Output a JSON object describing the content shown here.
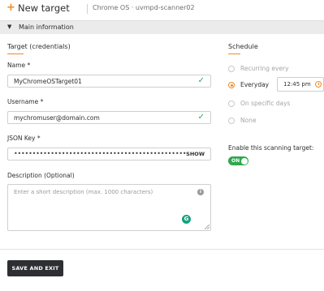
{
  "header": {
    "title": "New target",
    "breadcrumb": "Chrome OS · uvmpd-scanner02"
  },
  "section": {
    "title": "Main information"
  },
  "credentials": {
    "title": "Target (credentials)",
    "name_label": "Name *",
    "name_value": "MyChromeOSTarget01",
    "username_label": "Username *",
    "username_value": "mychromuser@domain.com",
    "json_key_label": "JSON Key *",
    "json_key_value": "•••••••••••••••••••••••••••••••••••••••••••••••••••••••••••••••••••••••",
    "json_key_show": "SHOW",
    "description_label": "Description (Optional)",
    "description_placeholder": "Enter a short description (max. 1000 characters)",
    "grammarly_glyph": "G"
  },
  "schedule": {
    "title": "Schedule",
    "options": [
      {
        "label": "Recurring every",
        "selected": false
      },
      {
        "label": "Everyday",
        "selected": true
      },
      {
        "label": "On specific days",
        "selected": false
      },
      {
        "label": "None",
        "selected": false
      }
    ],
    "time_value": "12:45 pm"
  },
  "enable": {
    "label": "Enable this scanning target:",
    "toggle_text": "ON",
    "enabled": true
  },
  "footer": {
    "save_label": "SAVE AND EXIT"
  },
  "colors": {
    "accent": "#f08a24",
    "success": "#2fa84f",
    "button_bg": "#2d2f33"
  }
}
